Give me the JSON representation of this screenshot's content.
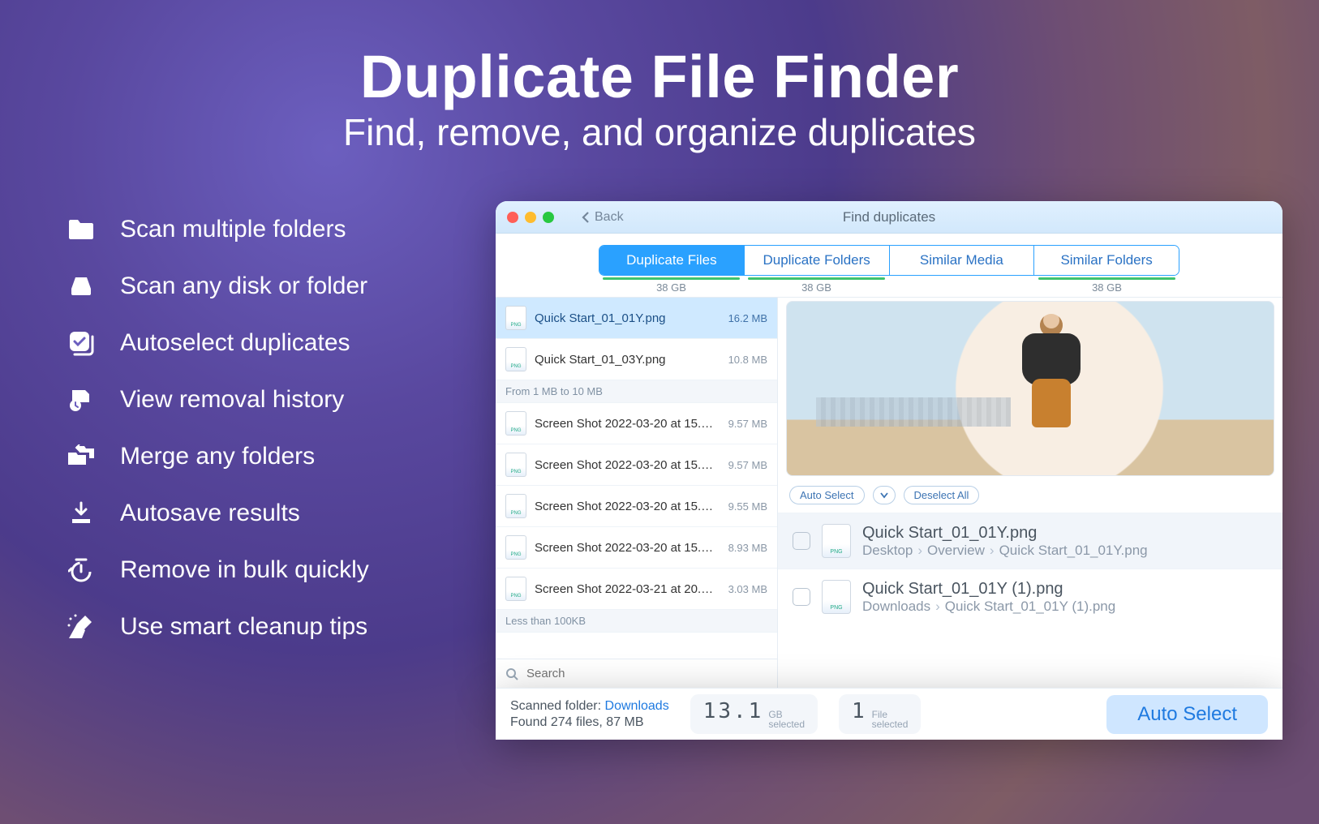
{
  "hero": {
    "title": "Duplicate File Finder",
    "subtitle": "Find, remove, and organize duplicates"
  },
  "features": [
    "Scan multiple folders",
    "Scan any disk or folder",
    "Autoselect duplicates",
    "View removal history",
    "Merge any folders",
    "Autosave results",
    "Remove in bulk quickly",
    "Use smart cleanup tips"
  ],
  "window": {
    "back": "Back",
    "title": "Find duplicates"
  },
  "tabs": [
    {
      "label": "Duplicate Files",
      "size": "38 GB",
      "active": true,
      "hasbar": true
    },
    {
      "label": "Duplicate Folders",
      "size": "38 GB",
      "active": false,
      "hasbar": true
    },
    {
      "label": "Similar Media",
      "size": "",
      "active": false,
      "hasbar": false
    },
    {
      "label": "Similar Folders",
      "size": "38 GB",
      "active": false,
      "hasbar": true
    }
  ],
  "groups": {
    "g1": "From 1 MB to 10 MB",
    "g2": "Less than 100KB"
  },
  "files": [
    {
      "name": "Quick Start_01_01Y.png",
      "size": "16.2 MB",
      "sel": true
    },
    {
      "name": "Quick Start_01_03Y.png",
      "size": "10.8 MB",
      "sel": false
    },
    {
      "name": "Screen Shot 2022-03-20 at 15.…",
      "size": "9.57 MB",
      "sel": false
    },
    {
      "name": "Screen Shot 2022-03-20 at 15.…",
      "size": "9.57 MB",
      "sel": false
    },
    {
      "name": "Screen Shot 2022-03-20 at 15.…",
      "size": "9.55 MB",
      "sel": false
    },
    {
      "name": "Screen Shot 2022-03-20 at 15.…",
      "size": "8.93 MB",
      "sel": false
    },
    {
      "name": "Screen Shot 2022-03-21 at 20.…",
      "size": "3.03 MB",
      "sel": false
    }
  ],
  "search_placeholder": "Search",
  "controls": {
    "auto_select": "Auto Select",
    "deselect_all": "Deselect All"
  },
  "dups": [
    {
      "name": "Quick Start_01_01Y.png",
      "path": [
        "Desktop",
        "Overview",
        "Quick Start_01_01Y.png"
      ],
      "active": true
    },
    {
      "name": "Quick Start_01_01Y (1).png",
      "path": [
        "Downloads",
        "Quick Start_01_01Y (1).png"
      ],
      "active": false
    }
  ],
  "footer": {
    "scanned_label": "Scanned folder:",
    "scanned_link": "Downloads",
    "found": "Found 274 files, 87 MB",
    "size_big": "13.1",
    "size_unit_top": "GB",
    "size_unit_bot": "selected",
    "count_big": "1",
    "count_unit_top": "File",
    "count_unit_bot": "selected",
    "auto_btn": "Auto Select"
  }
}
